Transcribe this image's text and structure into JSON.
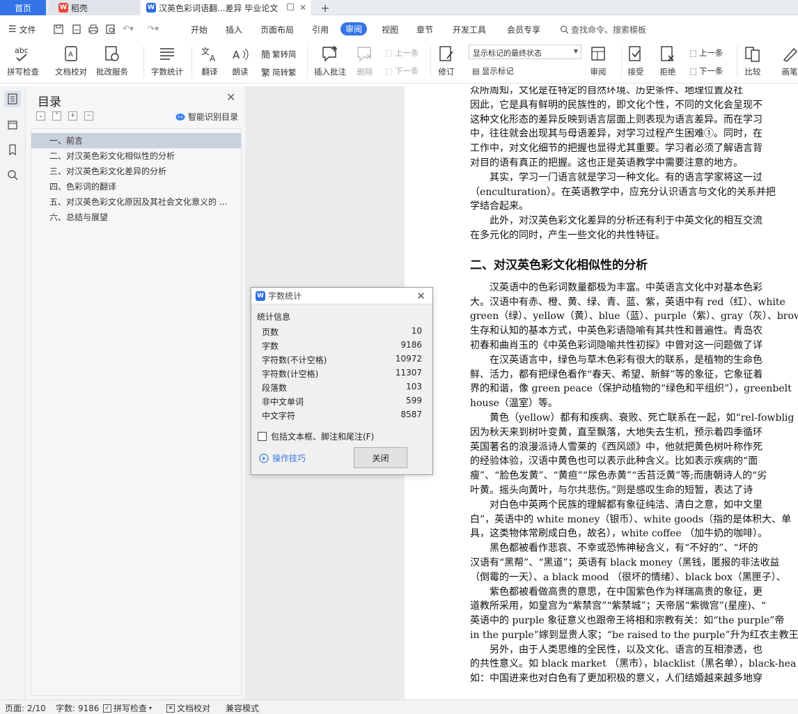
{
  "tabs": {
    "home": "首页",
    "wps": "稻壳",
    "doc": "汉英色彩词语翻...差异 毕业论文"
  },
  "menu": [
    "文件",
    "开始",
    "插入",
    "页面布局",
    "引用",
    "审阅",
    "视图",
    "章节",
    "开发工具",
    "会员专享"
  ],
  "menu_active": "审阅",
  "search_cmd": "查找命令、搜索模板",
  "ribbon": {
    "spell": "拼写检查",
    "proof": "文档校对",
    "batch": "批改服务",
    "wordcount": "字数统计",
    "translate": "翻译",
    "read": "朗读",
    "to_trad": "繁转简",
    "to_simp": "简转繁",
    "insert_comment": "插入批注",
    "delete": "删除",
    "prev": "上一条",
    "next": "下一条",
    "revise": "修订",
    "markup_select": "显示标记的最终状态",
    "show_markup": "显示标记",
    "review": "审阅",
    "accept": "接受",
    "reject": "拒绝",
    "prev2": "上一条",
    "next2": "下一条",
    "compare": "比较",
    "ink": "画笔"
  },
  "toc": {
    "title": "目录",
    "smart": "智能识别目录",
    "items": [
      "一、前言",
      "二、对汉英色彩文化相似性的分析",
      "三、对汉英色彩文化差异的分析",
      "四、色彩词的翻译",
      "五、对汉英色彩文化原因及其社会文化意义的 ...",
      "六、总结与展望"
    ]
  },
  "dialog": {
    "title": "字数统计",
    "section": "统计信息",
    "stats": [
      {
        "label": "页数",
        "value": "10"
      },
      {
        "label": "字数",
        "value": "9186"
      },
      {
        "label": "字符数(不计空格)",
        "value": "10972"
      },
      {
        "label": "字符数(计空格)",
        "value": "11307"
      },
      {
        "label": "段落数",
        "value": "103"
      },
      {
        "label": "非中文单词",
        "value": "599"
      },
      {
        "label": "中文字符",
        "value": "8587"
      }
    ],
    "checkbox": "包括文本框、脚注和尾注(F)",
    "tips": "操作技巧",
    "close": "关闭"
  },
  "document": {
    "lines1": [
      "众所周知，文化是在特定的自然环境、历史条件、地理位置及社",
      "因此，它是具有鲜明的民族性的，即文化个性，不同的文化会呈现不",
      "这种文化形态的差异反映到语言层面上则表现为语言差异。而在学习",
      "中，往往就会出现其与母语差异，对学习过程产生困难①。同时，在",
      "工作中，对文化细节的把握也显得尤其重要。学习者必须了解语言背",
      "对目的语有真正的把握。这也正是英语教学中需要注意的地方。",
      "　　其实，学习一门语言就是学习一种文化。有的语言学家将这一过",
      "（enculturation）。在英语教学中，应充分认识语言与文化的关系并把",
      "学结合起来。",
      "　　此外，对汉英色彩文化差异的分析还有利于中英文化的相互交流",
      "在多元化的同时，产生一些文化的共性特征。"
    ],
    "heading": "二、对汉英色彩文化相似性的分析",
    "lines2": [
      "　　汉英语中的色彩词数量都极为丰富。中英语言文化中对基本色彩",
      "大。汉语中有赤、橙、黄、绿、青、蓝、紫，英语中有 red（红）、white",
      "green（绿）、yellow（黄）、blue（蓝）、purple（紫）、gray（灰）、brow",
      "生存和认知的基本方式，中英色彩语隐喻有其共性和普遍性。青岛农",
      "初春和曲肖玉的《中英色彩词隐喻共性初探》中曾对这一问题做了详",
      "　　在汉英语言中，绿色与草木色彩有很大的联系，是植物的生命色",
      "鲜、活力，都有把绿色看作“春天、希望、新鲜”等的象征，它象征着",
      "界的和谐，像  green peace（保护动植物的“绿色和平组织”），greenbelt",
      "house（温室）等。",
      "　　黄色（yellow）都有和疾病、衰败、死亡联系在一起，如“rel-fowblig",
      "因为秋天来到树叶变黄，直至飘落，大地失去生机，预示着四季循环",
      "英国著名的浪漫派诗人雪莱的《西风颂》中，他就把黄色树叶称作死",
      "的经验体验，汉语中黄色也可以表示此种含义。比如表示疾病的“面",
      "瘦”、“脸色发黄”、“黄疸”“尿色赤黄”“舌苔泛黄”等;而唐朝诗人的“劣",
      "叶黄。摇头向黄叶，与尔共悲伤。”则是感叹生命的短暂，表达了诗",
      "　　对白色中英两个民族的理解都有象征纯洁、清白之意，如中文里",
      "白”，英语中的 white money（银币）、white goods（指的是体积大、单",
      "具，这类物体常刷成白色，故名），white coffee （加牛奶的咖啡）。",
      "　　黑色都被看作悲哀、不幸或恐怖神秘含义，有“不好的”、“坏的",
      "汉语有“黑帮”、“黑道”；英语有 black money（黑钱，匿报的非法收益",
      "（倒霉的一天）、a black mood （很坏的情绪）、black box（黑匣子）、",
      "　　紫色都被看做高贵的意思，在中国紫色作为祥瑞高贵的象征，更",
      "道教所采用，如皇宫为“紫禁宫”“紫禁城”；天帝居“紫微宫”(星座)、“",
      "英语中的 purple 象征意义也跟帝王将相和宗教有关：如“the purple”帝",
      "in the purple”嫁到显贵人家；“be raised to the purple”升为红衣主教王室",
      "　　另外，由于人类思维的全民性，以及文化、语言的互相渗透，也",
      "的共性意义。如 black market （黑市），blacklist（黑名单），black-hea",
      "如：中国进来也对白色有了更加积极的意义，人们结婚越来越多地穿"
    ]
  },
  "status": {
    "page": "页面: 2/10",
    "words": "字数: 9186",
    "spell": "拼写检查",
    "proof": "文档校对",
    "compat": "兼容模式"
  },
  "colors": {
    "accent": "#3474e6"
  }
}
